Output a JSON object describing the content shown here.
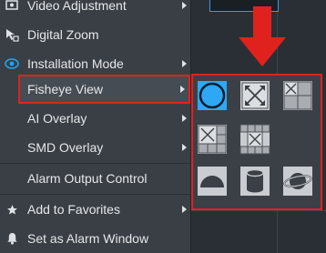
{
  "menu": {
    "items": [
      {
        "label": "Video Adjustment",
        "icon": "video-adjust-icon",
        "has_submenu": true
      },
      {
        "label": "Digital Zoom",
        "icon": "digital-zoom-icon",
        "has_submenu": false
      },
      {
        "label": "Installation Mode",
        "icon": "installation-mode-icon",
        "has_submenu": true
      },
      {
        "label": "Fisheye View",
        "icon": "",
        "has_submenu": true,
        "highlighted": true
      },
      {
        "label": "AI Overlay",
        "icon": "",
        "has_submenu": true
      },
      {
        "label": "SMD Overlay",
        "icon": "",
        "has_submenu": true
      },
      {
        "label": "Alarm Output Control",
        "icon": "",
        "has_submenu": false
      },
      {
        "label": "Add to Favorites",
        "icon": "star-icon",
        "has_submenu": true
      },
      {
        "label": "Set as Alarm Window",
        "icon": "bell-icon",
        "has_submenu": false
      }
    ]
  },
  "fisheye_submenu": {
    "options": [
      {
        "name": "fisheye-original-icon",
        "selected": true
      },
      {
        "name": "panorama-expand-icon",
        "selected": false
      },
      {
        "name": "1p3-layout-icon",
        "selected": false
      },
      {
        "name": "1p6-layout-icon",
        "selected": false
      },
      {
        "name": "1p8-layout-icon",
        "selected": false
      },
      {
        "name": "semisphere-icon",
        "selected": false
      },
      {
        "name": "cylinder-icon",
        "selected": false
      },
      {
        "name": "sphere-icon",
        "selected": false
      }
    ]
  },
  "colors": {
    "highlight_border": "#e0221e",
    "selected_tile": "#2ea8f5",
    "menu_bg": "#3a3f45",
    "text": "#e6e8ea"
  }
}
